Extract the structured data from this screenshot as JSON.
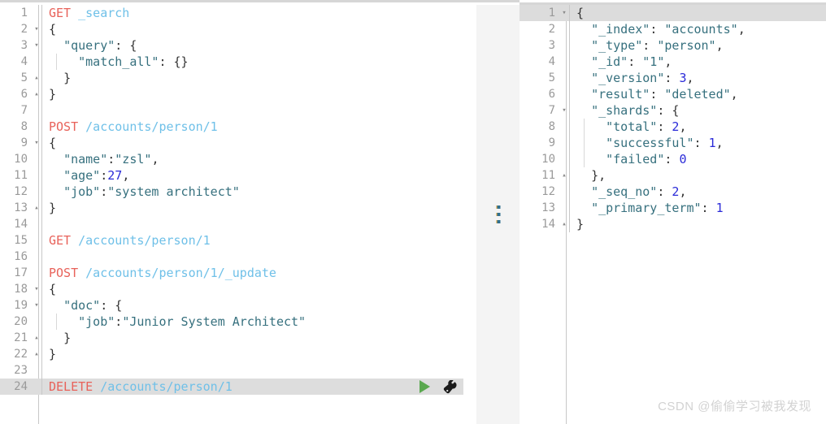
{
  "app": {
    "name": "kibana-dev-tools-console",
    "watermark": "CSDN @偷偷学习被我发现"
  },
  "splitter": {
    "name": "pane-splitter",
    "handle_dots": 3
  },
  "request_editor": {
    "title": "Console request editor",
    "active_line": 24,
    "actions": {
      "play_label": "Send request",
      "wrench_label": "Request options"
    },
    "lines": [
      {
        "n": "1",
        "fold": "",
        "indent": 0,
        "tokens": [
          {
            "t": "method",
            "v": "GET"
          },
          {
            "t": "plain",
            "v": " "
          },
          {
            "t": "url",
            "v": "_search"
          }
        ]
      },
      {
        "n": "2",
        "fold": "▾",
        "indent": 0,
        "tokens": [
          {
            "t": "punc",
            "v": "{"
          }
        ]
      },
      {
        "n": "3",
        "fold": "▾",
        "indent": 0,
        "tokens": [
          {
            "t": "plain",
            "v": "  "
          },
          {
            "t": "key",
            "v": "\"query\""
          },
          {
            "t": "punc",
            "v": ": {"
          }
        ]
      },
      {
        "n": "4",
        "fold": "",
        "indent": 1,
        "tokens": [
          {
            "t": "plain",
            "v": "    "
          },
          {
            "t": "key",
            "v": "\"match_all\""
          },
          {
            "t": "punc",
            "v": ": {}"
          }
        ]
      },
      {
        "n": "5",
        "fold": "▴",
        "indent": 0,
        "tokens": [
          {
            "t": "plain",
            "v": "  "
          },
          {
            "t": "punc",
            "v": "}"
          }
        ]
      },
      {
        "n": "6",
        "fold": "▴",
        "indent": 0,
        "tokens": [
          {
            "t": "punc",
            "v": "}"
          }
        ]
      },
      {
        "n": "7",
        "fold": "",
        "indent": 0,
        "tokens": []
      },
      {
        "n": "8",
        "fold": "",
        "indent": 0,
        "tokens": [
          {
            "t": "method",
            "v": "POST"
          },
          {
            "t": "plain",
            "v": " "
          },
          {
            "t": "url",
            "v": "/accounts/person/1"
          }
        ]
      },
      {
        "n": "9",
        "fold": "▾",
        "indent": 0,
        "tokens": [
          {
            "t": "punc",
            "v": "{"
          }
        ]
      },
      {
        "n": "10",
        "fold": "",
        "indent": 0,
        "tokens": [
          {
            "t": "plain",
            "v": "  "
          },
          {
            "t": "key",
            "v": "\"name\""
          },
          {
            "t": "punc",
            "v": ":"
          },
          {
            "t": "str",
            "v": "\"zsl\""
          },
          {
            "t": "punc",
            "v": ","
          }
        ]
      },
      {
        "n": "11",
        "fold": "",
        "indent": 0,
        "tokens": [
          {
            "t": "plain",
            "v": "  "
          },
          {
            "t": "key",
            "v": "\"age\""
          },
          {
            "t": "punc",
            "v": ":"
          },
          {
            "t": "num",
            "v": "27"
          },
          {
            "t": "punc",
            "v": ","
          }
        ]
      },
      {
        "n": "12",
        "fold": "",
        "indent": 0,
        "tokens": [
          {
            "t": "plain",
            "v": "  "
          },
          {
            "t": "key",
            "v": "\"job\""
          },
          {
            "t": "punc",
            "v": ":"
          },
          {
            "t": "str",
            "v": "\"system architect\""
          }
        ]
      },
      {
        "n": "13",
        "fold": "▴",
        "indent": 0,
        "tokens": [
          {
            "t": "punc",
            "v": "}"
          }
        ]
      },
      {
        "n": "14",
        "fold": "",
        "indent": 0,
        "tokens": []
      },
      {
        "n": "15",
        "fold": "",
        "indent": 0,
        "tokens": [
          {
            "t": "method",
            "v": "GET"
          },
          {
            "t": "plain",
            "v": " "
          },
          {
            "t": "url",
            "v": "/accounts/person/1"
          }
        ]
      },
      {
        "n": "16",
        "fold": "",
        "indent": 0,
        "tokens": []
      },
      {
        "n": "17",
        "fold": "",
        "indent": 0,
        "tokens": [
          {
            "t": "method",
            "v": "POST"
          },
          {
            "t": "plain",
            "v": " "
          },
          {
            "t": "url",
            "v": "/accounts/person/1/_update"
          }
        ]
      },
      {
        "n": "18",
        "fold": "▾",
        "indent": 0,
        "tokens": [
          {
            "t": "punc",
            "v": "{"
          }
        ]
      },
      {
        "n": "19",
        "fold": "▾",
        "indent": 0,
        "tokens": [
          {
            "t": "plain",
            "v": "  "
          },
          {
            "t": "key",
            "v": "\"doc\""
          },
          {
            "t": "punc",
            "v": ": {"
          }
        ]
      },
      {
        "n": "20",
        "fold": "",
        "indent": 1,
        "tokens": [
          {
            "t": "plain",
            "v": "    "
          },
          {
            "t": "key",
            "v": "\"job\""
          },
          {
            "t": "punc",
            "v": ":"
          },
          {
            "t": "str",
            "v": "\"Junior System Architect\""
          }
        ]
      },
      {
        "n": "21",
        "fold": "▴",
        "indent": 0,
        "tokens": [
          {
            "t": "plain",
            "v": "  "
          },
          {
            "t": "punc",
            "v": "}"
          }
        ]
      },
      {
        "n": "22",
        "fold": "▴",
        "indent": 0,
        "tokens": [
          {
            "t": "punc",
            "v": "}"
          }
        ]
      },
      {
        "n": "23",
        "fold": "",
        "indent": 0,
        "tokens": []
      },
      {
        "n": "24",
        "fold": "",
        "indent": 0,
        "tokens": [
          {
            "t": "method",
            "v": "DELETE"
          },
          {
            "t": "plain",
            "v": " "
          },
          {
            "t": "url",
            "v": "/accounts/person/1"
          }
        ]
      }
    ]
  },
  "response_viewer": {
    "title": "Console response viewer",
    "active_line": 1,
    "lines": [
      {
        "n": "1",
        "fold": "▾",
        "indent": 0,
        "tokens": [
          {
            "t": "punc",
            "v": "{"
          }
        ]
      },
      {
        "n": "2",
        "fold": "",
        "indent": 0,
        "tokens": [
          {
            "t": "plain",
            "v": "  "
          },
          {
            "t": "key",
            "v": "\"_index\""
          },
          {
            "t": "punc",
            "v": ": "
          },
          {
            "t": "str",
            "v": "\"accounts\""
          },
          {
            "t": "punc",
            "v": ","
          }
        ]
      },
      {
        "n": "3",
        "fold": "",
        "indent": 0,
        "tokens": [
          {
            "t": "plain",
            "v": "  "
          },
          {
            "t": "key",
            "v": "\"_type\""
          },
          {
            "t": "punc",
            "v": ": "
          },
          {
            "t": "str",
            "v": "\"person\""
          },
          {
            "t": "punc",
            "v": ","
          }
        ]
      },
      {
        "n": "4",
        "fold": "",
        "indent": 0,
        "tokens": [
          {
            "t": "plain",
            "v": "  "
          },
          {
            "t": "key",
            "v": "\"_id\""
          },
          {
            "t": "punc",
            "v": ": "
          },
          {
            "t": "str",
            "v": "\"1\""
          },
          {
            "t": "punc",
            "v": ","
          }
        ]
      },
      {
        "n": "5",
        "fold": "",
        "indent": 0,
        "tokens": [
          {
            "t": "plain",
            "v": "  "
          },
          {
            "t": "key",
            "v": "\"_version\""
          },
          {
            "t": "punc",
            "v": ": "
          },
          {
            "t": "num",
            "v": "3"
          },
          {
            "t": "punc",
            "v": ","
          }
        ]
      },
      {
        "n": "6",
        "fold": "",
        "indent": 0,
        "tokens": [
          {
            "t": "plain",
            "v": "  "
          },
          {
            "t": "key",
            "v": "\"result\""
          },
          {
            "t": "punc",
            "v": ": "
          },
          {
            "t": "str",
            "v": "\"deleted\""
          },
          {
            "t": "punc",
            "v": ","
          }
        ]
      },
      {
        "n": "7",
        "fold": "▾",
        "indent": 0,
        "tokens": [
          {
            "t": "plain",
            "v": "  "
          },
          {
            "t": "key",
            "v": "\"_shards\""
          },
          {
            "t": "punc",
            "v": ": {"
          }
        ]
      },
      {
        "n": "8",
        "fold": "",
        "indent": 1,
        "tokens": [
          {
            "t": "plain",
            "v": "    "
          },
          {
            "t": "key",
            "v": "\"total\""
          },
          {
            "t": "punc",
            "v": ": "
          },
          {
            "t": "num",
            "v": "2"
          },
          {
            "t": "punc",
            "v": ","
          }
        ]
      },
      {
        "n": "9",
        "fold": "",
        "indent": 1,
        "tokens": [
          {
            "t": "plain",
            "v": "    "
          },
          {
            "t": "key",
            "v": "\"successful\""
          },
          {
            "t": "punc",
            "v": ": "
          },
          {
            "t": "num",
            "v": "1"
          },
          {
            "t": "punc",
            "v": ","
          }
        ]
      },
      {
        "n": "10",
        "fold": "",
        "indent": 1,
        "tokens": [
          {
            "t": "plain",
            "v": "    "
          },
          {
            "t": "key",
            "v": "\"failed\""
          },
          {
            "t": "punc",
            "v": ": "
          },
          {
            "t": "num",
            "v": "0"
          }
        ]
      },
      {
        "n": "11",
        "fold": "▴",
        "indent": 0,
        "tokens": [
          {
            "t": "plain",
            "v": "  "
          },
          {
            "t": "punc",
            "v": "},"
          }
        ]
      },
      {
        "n": "12",
        "fold": "",
        "indent": 0,
        "tokens": [
          {
            "t": "plain",
            "v": "  "
          },
          {
            "t": "key",
            "v": "\"_seq_no\""
          },
          {
            "t": "punc",
            "v": ": "
          },
          {
            "t": "num",
            "v": "2"
          },
          {
            "t": "punc",
            "v": ","
          }
        ]
      },
      {
        "n": "13",
        "fold": "",
        "indent": 0,
        "tokens": [
          {
            "t": "plain",
            "v": "  "
          },
          {
            "t": "key",
            "v": "\"_primary_term\""
          },
          {
            "t": "punc",
            "v": ": "
          },
          {
            "t": "num",
            "v": "1"
          }
        ]
      },
      {
        "n": "14",
        "fold": "▴",
        "indent": 0,
        "tokens": [
          {
            "t": "punc",
            "v": "}"
          }
        ]
      }
    ]
  },
  "colors": {
    "method": "#e8625a",
    "url": "#6fc0e8",
    "key": "#36707e",
    "string": "#36707e",
    "number": "#2a2ad8",
    "gutter_text": "#9a9a9a",
    "active_line_bg": "#dddddd",
    "splitter_bg": "#f4f4f4",
    "play_green": "#5aa84f"
  }
}
